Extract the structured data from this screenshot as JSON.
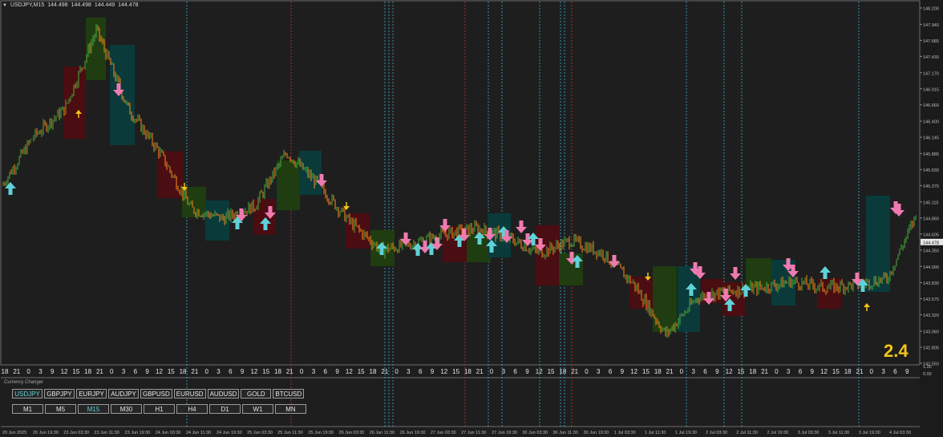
{
  "window": {
    "symbol": "USDJPY,M15",
    "quotes": [
      "144.498",
      "144.498",
      "144.449",
      "144.478"
    ],
    "collapse_glyph": "▼"
  },
  "score": "2.4",
  "price_axis": {
    "labels": [
      "148.200",
      "147.940",
      "147.685",
      "147.430",
      "147.170",
      "146.915",
      "146.660",
      "146.400",
      "146.145",
      "145.885",
      "145.630",
      "145.375",
      "145.115",
      "144.860",
      "144.605",
      "144.350",
      "144.090",
      "143.830",
      "143.575",
      "143.320",
      "143.060",
      "142.805",
      "142.550"
    ],
    "current_price": "144.478",
    "indicator_labels": [
      "1.00",
      "0.00"
    ]
  },
  "hour_axis": {
    "labels": [
      "18",
      "21",
      "0",
      "3",
      "9",
      "12",
      "15",
      "18",
      "21",
      "0",
      "3",
      "6",
      "9",
      "12",
      "15",
      "18",
      "21",
      "0",
      "3",
      "6",
      "9",
      "12",
      "15",
      "18",
      "21",
      "0",
      "3",
      "6",
      "9",
      "12",
      "15",
      "18",
      "21",
      "0",
      "3",
      "6",
      "9",
      "12",
      "15",
      "18",
      "21",
      "0",
      "3",
      "6",
      "9",
      "12",
      "15",
      "18",
      "21",
      "0",
      "3",
      "6",
      "9",
      "12",
      "15",
      "18",
      "21",
      "0",
      "3",
      "6",
      "9",
      "12",
      "15",
      "18",
      "21",
      "0",
      "3",
      "6",
      "9",
      "12",
      "15",
      "18",
      "21",
      "0",
      "3",
      "6",
      "9"
    ]
  },
  "time_axis": {
    "labels": [
      "20 Jun 2025",
      "20 Jun 19:30",
      "23 Jun 03:30",
      "23 Jun 11:30",
      "23 Jun 19:30",
      "24 Jun 03:30",
      "24 Jun 11:30",
      "24 Jun 19:30",
      "25 Jun 03:30",
      "25 Jun 11:30",
      "25 Jun 19:30",
      "26 Jun 03:30",
      "26 Jun 11:30",
      "26 Jun 19:30",
      "27 Jun 03:30",
      "27 Jun 11:30",
      "27 Jun 19:30",
      "30 Jun 03:30",
      "30 Jun 11:30",
      "30 Jun 19:30",
      "1 Jul 03:30",
      "1 Jul 11:30",
      "1 Jul 19:30",
      "2 Jul 03:30",
      "2 Jul 11:30",
      "2 Jul 19:30",
      "3 Jul 03:30",
      "3 Jul 11:30",
      "3 Jul 19:30",
      "4 Jul 03:30"
    ]
  },
  "currency_changer": {
    "title": "Currency Changer",
    "symbols": [
      "USDJPY",
      "GBPJPY",
      "EURJPY",
      "AUDJPY",
      "GBPUSD",
      "EURUSD",
      "AUDUSD",
      "GOLD",
      "BTCUSD"
    ],
    "active_symbol": "USDJPY",
    "timeframes": [
      "M1",
      "M5",
      "M15",
      "M30",
      "H1",
      "H4",
      "D1",
      "W1",
      "MN"
    ],
    "active_timeframe": "M15"
  },
  "colors": {
    "background": "#1e1e1e",
    "bull_candle": "#4caf3f",
    "bear_candle": "#ff8c1a",
    "box_red": "#4a0d12",
    "box_green": "#1f3d10",
    "box_teal": "#0a3a3a",
    "up_arrow": "#5fd2d8",
    "down_arrow": "#f07ab0",
    "small_arrow": "#f5c518",
    "vline_blue": "#3aaed8",
    "vline_red": "#d03030",
    "accent": "#5fd2d8"
  },
  "chart_data": {
    "type": "line",
    "xlabel": "",
    "ylabel": "",
    "ylim": [
      142.55,
      148.2
    ],
    "x": [
      "20 Jun 2025",
      "20 Jun 19:30",
      "23 Jun 03:30",
      "23 Jun 11:30",
      "23 Jun 19:30",
      "24 Jun 03:30",
      "24 Jun 11:30",
      "24 Jun 19:30",
      "25 Jun 03:30",
      "25 Jun 11:30",
      "25 Jun 19:30",
      "26 Jun 03:30",
      "26 Jun 11:30",
      "26 Jun 19:30",
      "27 Jun 03:30",
      "27 Jun 11:30",
      "27 Jun 19:30",
      "30 Jun 03:30",
      "30 Jun 11:30",
      "30 Jun 19:30",
      "1 Jul 03:30",
      "1 Jul 11:30",
      "1 Jul 19:30",
      "2 Jul 03:30",
      "2 Jul 11:30",
      "2 Jul 19:30",
      "3 Jul 03:30",
      "3 Jul 11:30",
      "3 Jul 19:30",
      "4 Jul 03:30"
    ],
    "series": [
      {
        "values": [
          145.37,
          146.15,
          146.6,
          147.85,
          146.6,
          145.9,
          145.0,
          144.85,
          145.05,
          145.9,
          145.4,
          144.8,
          144.35,
          144.45,
          144.6,
          144.7,
          144.55,
          144.3,
          144.5,
          144.3,
          143.8,
          143.0,
          143.6,
          143.7,
          143.75,
          143.85,
          143.75,
          143.8,
          143.9,
          145.0
        ]
      }
    ]
  }
}
